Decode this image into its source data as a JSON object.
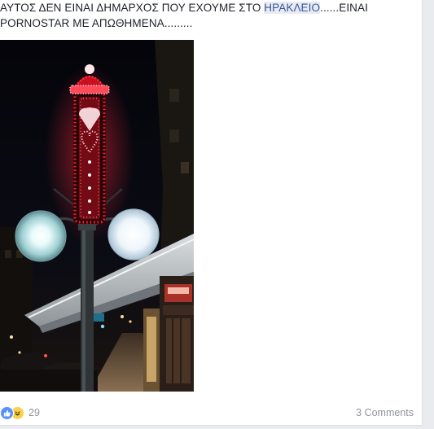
{
  "post": {
    "text_before_mention": "ΑΥΤΟΣ ΔΕΝ ΕΙΝΑΙ ΔΗΜΑΡΧΟΣ ΠΟΥ ΕΧΟΥΜΕ ΣΤΟ ",
    "mention": "ΗΡΑΚΛΕΙΟ",
    "text_after_mention": "......ΕΙΝΑΙ PORNOSTAR ΜΕ ΑΠΩΘΗΜΕΝΑ.........",
    "photo_icon": "christmas-lamp-post-photo"
  },
  "footer": {
    "reaction_icons": [
      "like-icon",
      "haha-icon"
    ],
    "reaction_count": "29",
    "comments_label": "3 Comments"
  },
  "colors": {
    "mention_bg": "#e9ebf4",
    "mention_text": "#365899",
    "like_blue": "#5890ff",
    "haha_yellow": "#f7d24b",
    "meta_gray": "#90949c"
  }
}
